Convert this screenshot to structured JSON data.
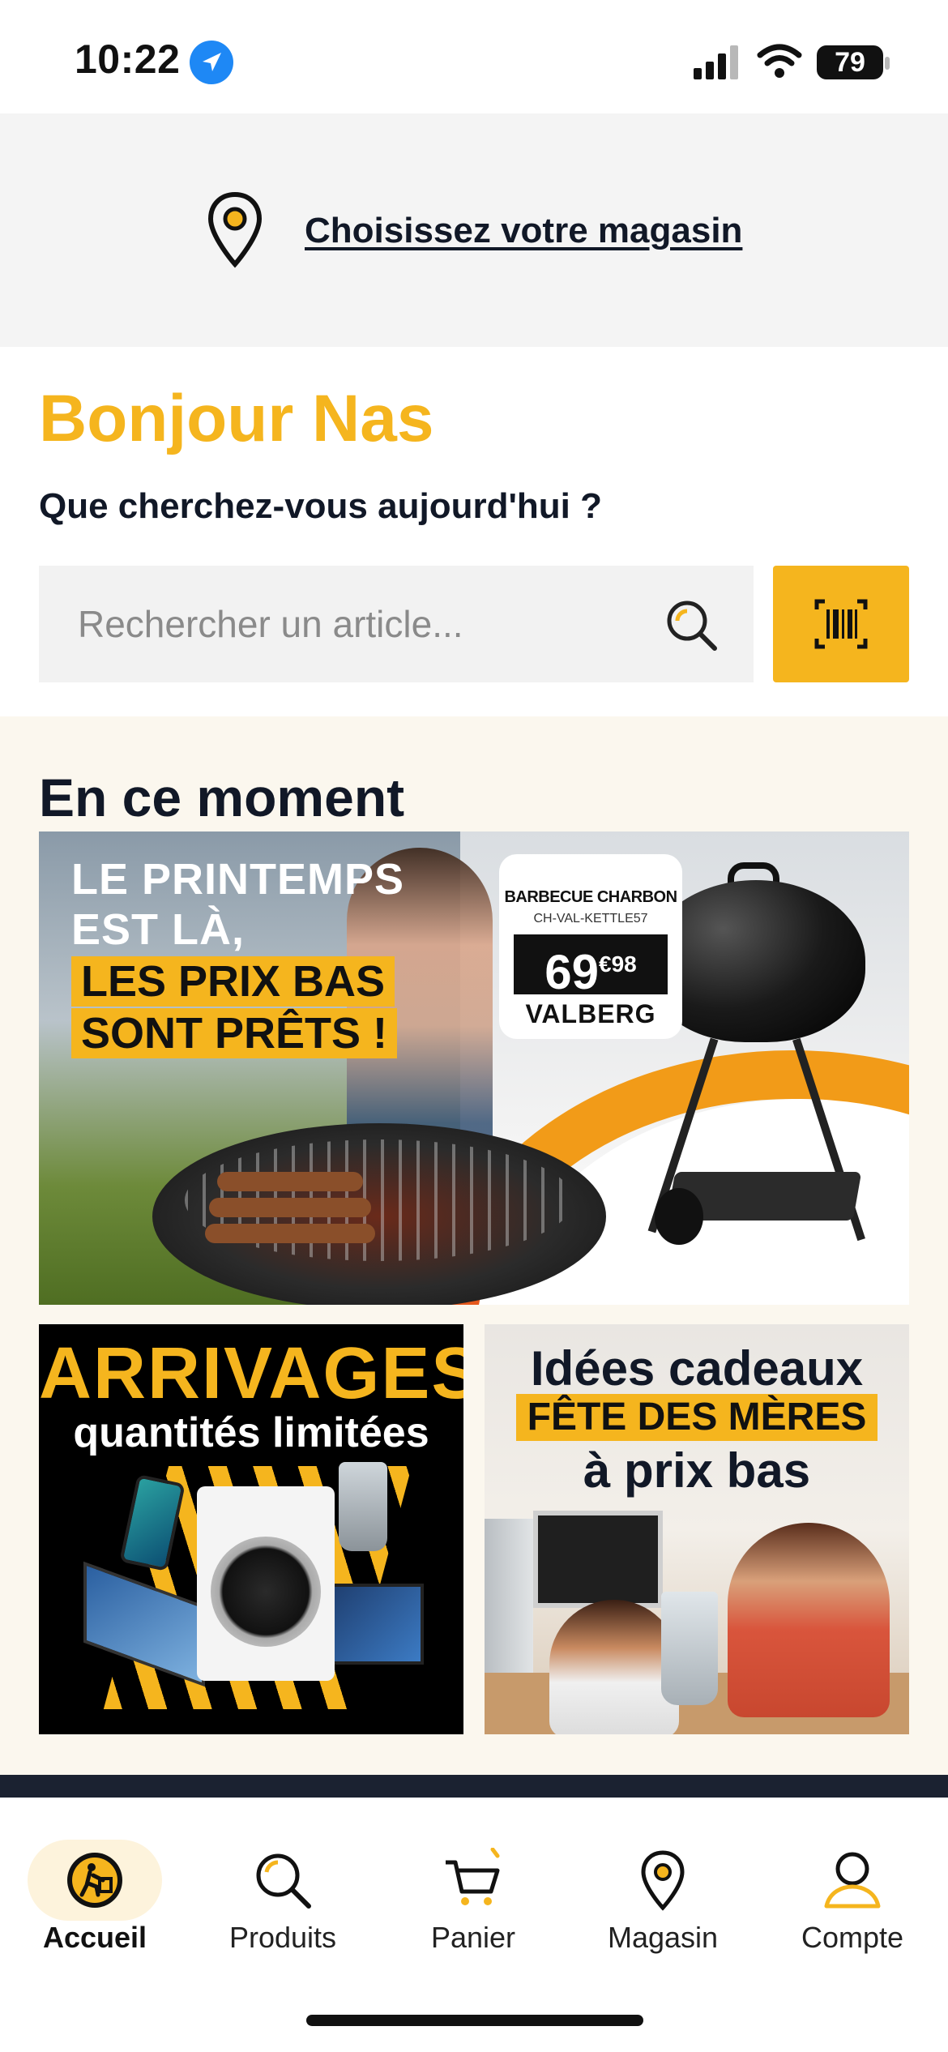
{
  "status_bar": {
    "time": "10:22",
    "battery": "79",
    "icons": [
      "location-arrow-icon",
      "signal-icon",
      "wifi-icon",
      "battery-icon"
    ]
  },
  "store": {
    "link": "Choisissez votre magasin",
    "icon": "map-pin-icon"
  },
  "greeting": {
    "title": "Bonjour Nas",
    "subtitle": "Que cherchez-vous aujourd'hui ?"
  },
  "search": {
    "placeholder": "Rechercher un article...",
    "icon": "search-icon",
    "scan_icon": "barcode-scan-icon"
  },
  "moments": {
    "title": "En ce moment",
    "main_banner": {
      "lines_white": [
        "LE PRINTEMPS",
        "EST LÀ,"
      ],
      "lines_yellow": [
        "LES PRIX BAS",
        "SONT PRÊTS !"
      ],
      "price_card": {
        "product": "BARBECUE CHARBON",
        "ref": "CH-VAL-KETTLE57",
        "price_main": "69",
        "price_currency": "€",
        "price_cents": "98",
        "brand": "VALBERG"
      }
    },
    "arrivages": {
      "title": "ARRIVAGES",
      "subtitle": "quantités limitées"
    },
    "cadeaux": {
      "title": "Idées cadeaux",
      "badge": "FÊTE DES MÈRES",
      "subtitle": "à prix bas"
    }
  },
  "nav": {
    "items": [
      {
        "label": "Accueil",
        "icon": "home-cart-icon",
        "active": true
      },
      {
        "label": "Produits",
        "icon": "search-icon",
        "active": false
      },
      {
        "label": "Panier",
        "icon": "cart-icon",
        "active": false
      },
      {
        "label": "Magasin",
        "icon": "map-pin-icon",
        "active": false
      },
      {
        "label": "Compte",
        "icon": "user-icon",
        "active": false
      }
    ]
  },
  "colors": {
    "accent": "#f5b51e",
    "text": "#111827",
    "store_bar_bg": "#f4f4f4",
    "section_bg": "#fbf7ee",
    "dark_strip": "#1b2231"
  }
}
